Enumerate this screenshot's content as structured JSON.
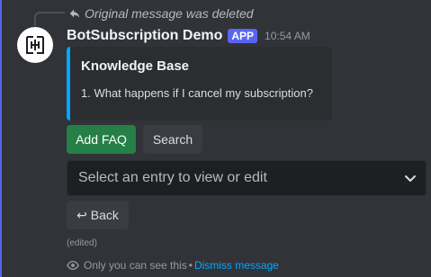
{
  "reply": {
    "text": "Original message was deleted",
    "icon": "reply-arrow-icon"
  },
  "message": {
    "username": "BotSubscription Demo",
    "badge": "APP",
    "timestamp": "10:54 AM",
    "avatar_icon": "bot-logo-icon",
    "edited": "(edited)"
  },
  "embed": {
    "accent_color": "#00a8fc",
    "title": "Knowledge Base",
    "description": "1. What happens if I cancel my subscription?"
  },
  "buttons": {
    "add_faq": "Add FAQ",
    "search": "Search",
    "back": "↩ Back"
  },
  "select": {
    "placeholder": "Select an entry to view or edit"
  },
  "ephemeral": {
    "text": "Only you can see this",
    "separator": "•",
    "dismiss": "Dismiss message",
    "icon": "eye-icon"
  },
  "colors": {
    "background": "#313338",
    "brand": "#5865f2",
    "success": "#248046",
    "link": "#00a8fc"
  }
}
